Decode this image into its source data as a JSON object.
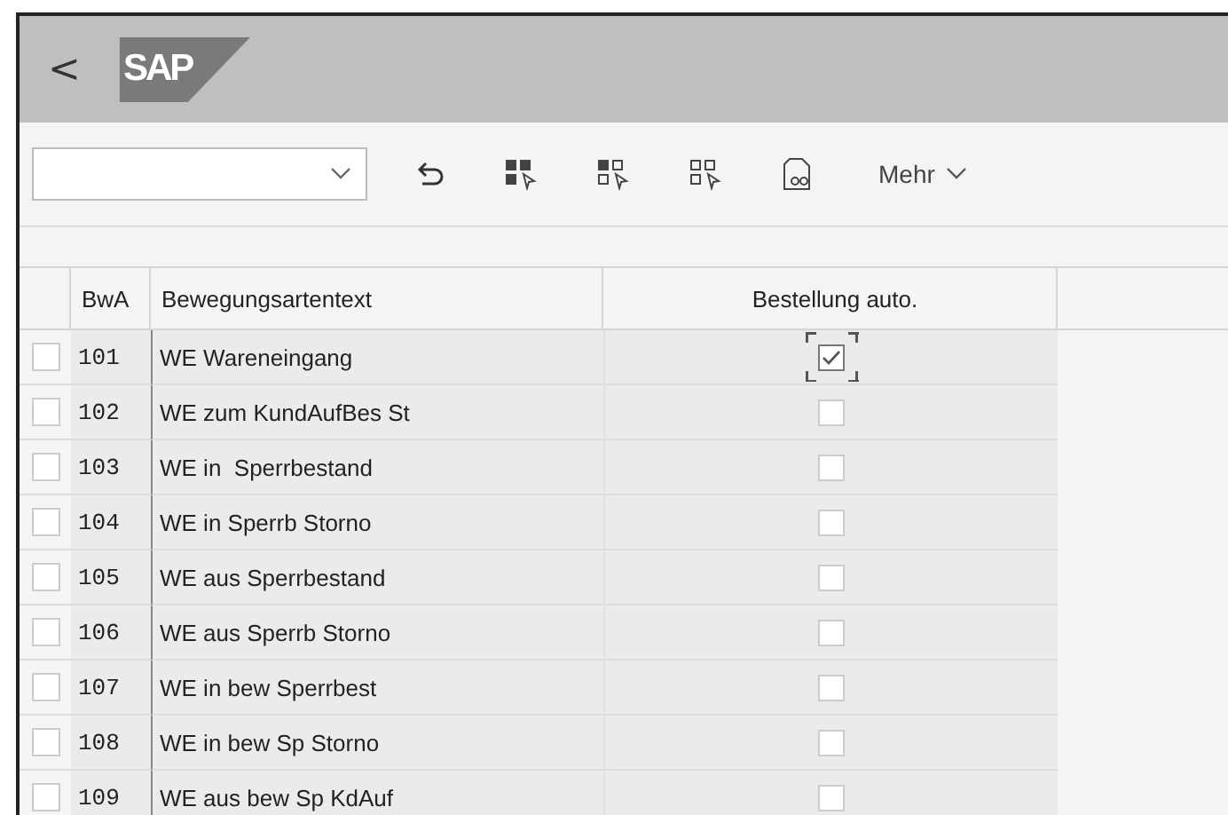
{
  "header": {
    "back_label": "<",
    "logo": "SAP"
  },
  "toolbar": {
    "buttons": [
      {
        "kind": "undo"
      },
      {
        "kind": "select-all"
      },
      {
        "kind": "select-block"
      },
      {
        "kind": "deselect-all"
      },
      {
        "kind": "view-details"
      }
    ],
    "more_label": "Mehr"
  },
  "table": {
    "columns": [
      "BwA",
      "Bewegungsartentext",
      "Bestellung auto."
    ],
    "rows": [
      {
        "selected": false,
        "bwa": "101",
        "text": "WE Wareneingang",
        "checked": true,
        "focused": true
      },
      {
        "selected": false,
        "bwa": "102",
        "text": "WE zum KundAufBes St",
        "checked": false,
        "focused": false
      },
      {
        "selected": false,
        "bwa": "103",
        "text": "WE in  Sperrbestand",
        "checked": false,
        "focused": false
      },
      {
        "selected": false,
        "bwa": "104",
        "text": "WE in Sperrb Storno",
        "checked": false,
        "focused": false
      },
      {
        "selected": false,
        "bwa": "105",
        "text": "WE aus Sperrbestand",
        "checked": false,
        "focused": false
      },
      {
        "selected": false,
        "bwa": "106",
        "text": "WE aus Sperrb Storno",
        "checked": false,
        "focused": false
      },
      {
        "selected": false,
        "bwa": "107",
        "text": "WE in bew Sperrbest",
        "checked": false,
        "focused": false
      },
      {
        "selected": false,
        "bwa": "108",
        "text": "WE in bew Sp Storno",
        "checked": false,
        "focused": false
      },
      {
        "selected": false,
        "bwa": "109",
        "text": "WE aus bew Sp KdAuf",
        "checked": false,
        "focused": false
      }
    ]
  }
}
